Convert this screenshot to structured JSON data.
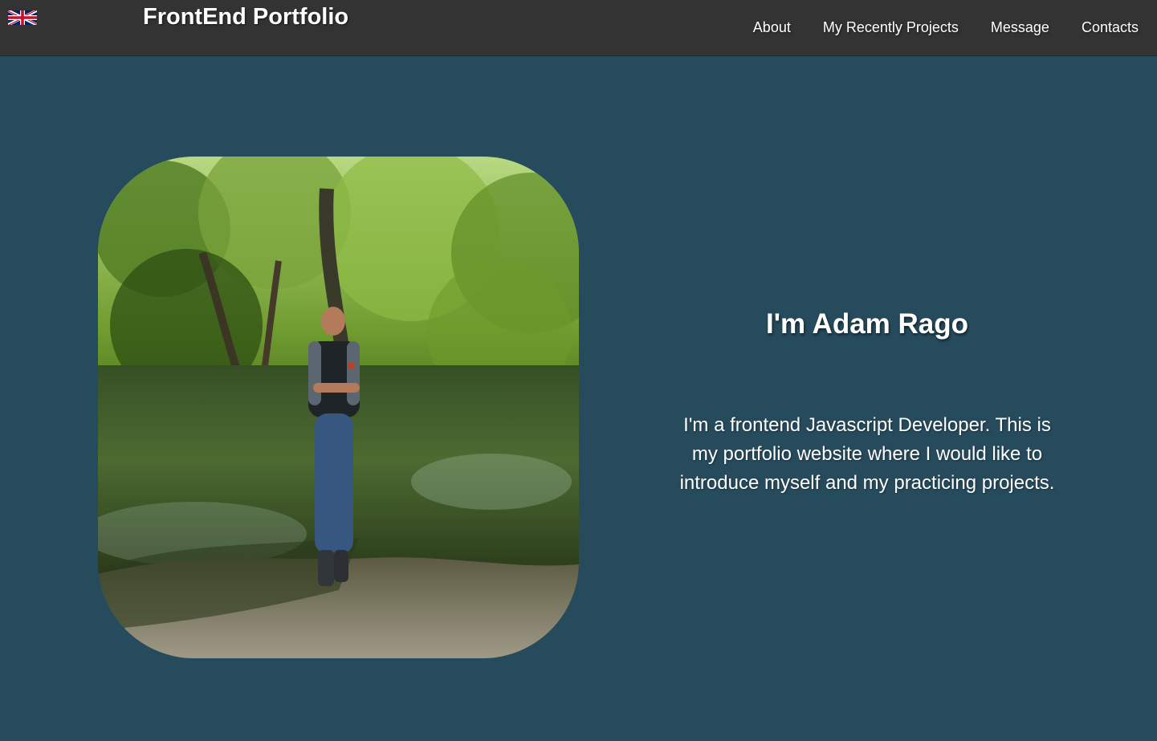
{
  "header": {
    "language_icon": "uk-flag-icon",
    "brand": "FrontEnd Portfolio",
    "nav": [
      {
        "label": "About"
      },
      {
        "label": "My Recently Projects"
      },
      {
        "label": "Message"
      },
      {
        "label": "Contacts"
      }
    ]
  },
  "hero": {
    "photo_subject": "man-by-forest-pond",
    "title": "I'm Adam Rago",
    "description": "I'm a frontend Javascript Developer. This is my portfolio website where I would like to introduce myself and my practicing projects."
  },
  "colors": {
    "header_bg": "#333333",
    "page_bg": "#264b5d",
    "text": "#ffffff"
  }
}
